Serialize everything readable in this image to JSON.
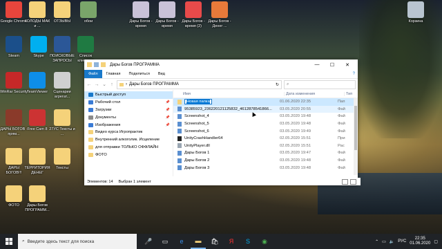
{
  "desktop": {
    "icons": [
      {
        "label": "Google Chrome",
        "color": "#e8453c"
      },
      {
        "label": "КОЛОДЫ МАК и ...",
        "color": "#f5d27a"
      },
      {
        "label": "ОТЗЫВЫ",
        "color": "#f5d27a"
      },
      {
        "label": "обои",
        "color": "#7aa56a"
      },
      {
        "label": "Дары Богов - время",
        "color": "#c9c2d8"
      },
      {
        "label": "Дары Богов - время",
        "color": "#c9c2d8"
      },
      {
        "label": "Дары Богов - время (2)",
        "color": "#e84a4a"
      },
      {
        "label": "Дары Богов - Денег ...",
        "color": "#e87a3a"
      },
      {
        "label": "Корзина",
        "color": "#b8c4d0"
      },
      {
        "label": "Steam",
        "color": "#1b4f8a"
      },
      {
        "label": "Skype",
        "color": "#00aff0"
      },
      {
        "label": "ПОИСКОВЫЕ ЗАПРОСЫ",
        "color": "#2b5797"
      },
      {
        "label": "Список клиентов",
        "color": "#1f7a42"
      },
      {
        "label": "WinRar Security",
        "color": "#c62828"
      },
      {
        "label": "TeamViewer",
        "color": "#0e8ee9"
      },
      {
        "label": "Сценарии агрегат...",
        "color": "#d0d0d0"
      },
      {
        "label": "ДАРЫ БОГОВ - прям...",
        "color": "#8a3a2a"
      },
      {
        "label": "Free Cam 8",
        "color": "#cc3333"
      },
      {
        "label": "27УС Тексты и ...",
        "color": "#f5d27a"
      },
      {
        "label": "ДАРЫ БОГОВ!!!",
        "color": "#f5d27a"
      },
      {
        "label": "ТЕРРИТОРИЯ ДЕНЕГ",
        "color": "#f5d27a"
      },
      {
        "label": "Тексты",
        "color": "#f5d27a"
      },
      {
        "label": "ФОТО",
        "color": "#f5d27a"
      },
      {
        "label": "Дары Богов ПРОГРАММ...",
        "color": "#f5d27a"
      }
    ]
  },
  "window": {
    "title": "Дары Богов ПРОГРАММА",
    "ribbon_tabs": [
      "Файл",
      "Главная",
      "Поделиться",
      "Вид"
    ],
    "address_path": "Дары Богов ПРОГРАММА",
    "search_placeholder": "Поиск: Дары Богов ПРОГРАММА",
    "columns": {
      "name": "Имя",
      "date": "Дата изменения",
      "type": "Тип"
    },
    "nav_items": [
      {
        "label": "Быстрый доступ",
        "color": "#1979ca",
        "pinned": false
      },
      {
        "label": "Рабочий стол",
        "color": "#3a7bd5",
        "pinned": true
      },
      {
        "label": "Загрузки",
        "color": "#3a7bd5",
        "pinned": true
      },
      {
        "label": "Документы",
        "color": "#8a8a8a",
        "pinned": true
      },
      {
        "label": "Изображения",
        "color": "#3a7bd5",
        "pinned": true
      },
      {
        "label": "Видео курса Игропрактик",
        "color": "#f5d27a",
        "pinned": false
      },
      {
        "label": "Внутренний алкоголик. Исцеление",
        "color": "#f5d27a",
        "pinned": false
      },
      {
        "label": "для отправки ТОЛЬКО ОФФЛАЙН",
        "color": "#f5d27a",
        "pinned": false
      },
      {
        "label": "ФОТО",
        "color": "#f5d27a",
        "pinned": false
      }
    ],
    "files": [
      {
        "name": "Новая папка",
        "date": "01.06.2020 22:35",
        "type": "Пап",
        "kind": "folder"
      },
      {
        "name": "95385923_236220121125832_4612878541866...",
        "date": "03.05.2020 20:55",
        "type": "Фай",
        "kind": "image"
      },
      {
        "name": "Screenshot_4",
        "date": "03.05.2020 19:48",
        "type": "Фай",
        "kind": "image"
      },
      {
        "name": "Screenshot_5",
        "date": "03.05.2020 19:48",
        "type": "Фай",
        "kind": "image"
      },
      {
        "name": "Screenshot_6",
        "date": "03.05.2020 19:49",
        "type": "Фай",
        "kind": "image"
      },
      {
        "name": "UnityCrashHandler64",
        "date": "02.05.2020 15:51",
        "type": "При",
        "kind": "app"
      },
      {
        "name": "UnityPlayer.dll",
        "date": "02.05.2020 15:51",
        "type": "Рас",
        "kind": "dll"
      },
      {
        "name": "Дары Богов 1",
        "date": "03.05.2020 19:47",
        "type": "Фай",
        "kind": "image"
      },
      {
        "name": "Дары Богов 2",
        "date": "03.05.2020 19:48",
        "type": "Фай",
        "kind": "image"
      },
      {
        "name": "Дары Богов 3",
        "date": "03.05.2020 19:48",
        "type": "Фай",
        "kind": "image"
      }
    ],
    "status": {
      "count": "Элементов: 14",
      "selected": "Выбран 1 элемент"
    }
  },
  "taskbar": {
    "search_placeholder": "Введите здесь текст для поиска",
    "lang": "РУС",
    "time": "22:35",
    "date": "01.06.2020"
  }
}
